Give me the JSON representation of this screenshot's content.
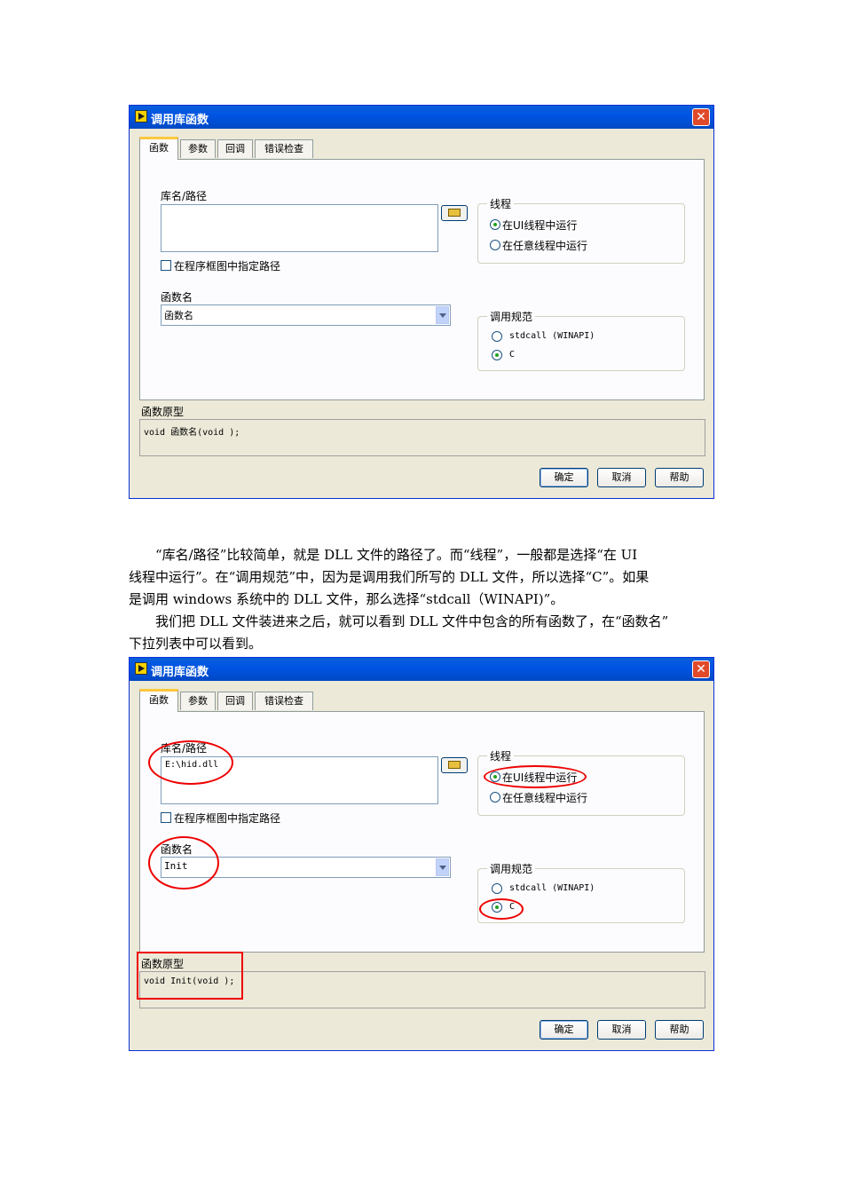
{
  "dialog": {
    "title": "调用库函数",
    "close_glyph": "✕",
    "tabs": [
      "函数",
      "参数",
      "回调",
      "错误检查"
    ],
    "library_label": "库名/路径",
    "specify_path_label": "在程序框图中指定路径",
    "function_name_label": "函数名",
    "thread_group": "线程",
    "thread_ui": "在UI线程中运行",
    "thread_any": "在任意线程中运行",
    "convention_group": "调用规范",
    "conv_stdcall": "stdcall (WINAPI)",
    "conv_c": "C",
    "prototype_label": "函数原型",
    "ok": "确定",
    "cancel": "取消",
    "help": "帮助"
  },
  "dialog1": {
    "library_path": "",
    "function_name": "函数名",
    "prototype": "void  函数名(void );"
  },
  "dialog2": {
    "library_path": "E:\\hid.dll",
    "function_name": "Init",
    "prototype": "void  Init(void );"
  },
  "text": {
    "para1_line1": "“库名/路径”比较简单，就是 DLL 文件的路径了。而“线程”，一般都是选择“在 UI",
    "para1_line2": "线程中运行”。在“调用规范”中，因为是调用我们所写的 DLL 文件，所以选择“C”。如果",
    "para1_line3": "是调用 windows 系统中的 DLL 文件，那么选择“stdcall（WINAPI)”。",
    "para2_line1": "我们把 DLL 文件装进来之后，就可以看到 DLL 文件中包含的所有函数了，在“函数名”",
    "para2_line2": "下拉列表中可以看到。"
  }
}
